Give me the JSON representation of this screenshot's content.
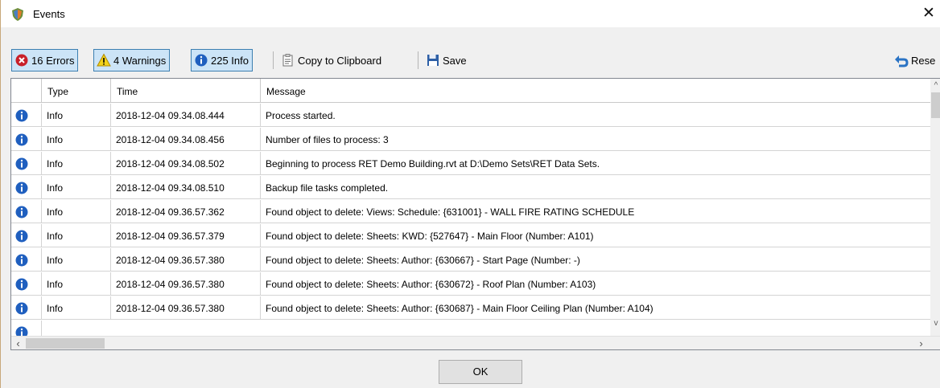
{
  "window": {
    "title": "Events",
    "close_glyph": "✕"
  },
  "toolbar": {
    "errors_label": "16 Errors",
    "warnings_label": "4 Warnings",
    "info_label": "225 Info",
    "copy_label": "Copy to Clipboard",
    "save_label": "Save",
    "reset_label": "Rese"
  },
  "table": {
    "columns": [
      "",
      "Type",
      "Time",
      "Message"
    ],
    "rows": [
      {
        "icon": "info-icon",
        "type": "Info",
        "time": "2018-12-04 09.34.08.444",
        "message": "Process started."
      },
      {
        "icon": "info-icon",
        "type": "Info",
        "time": "2018-12-04 09.34.08.456",
        "message": "Number of files to process: 3"
      },
      {
        "icon": "info-icon",
        "type": "Info",
        "time": "2018-12-04 09.34.08.502",
        "message": "Beginning to process RET Demo Building.rvt at D:\\Demo Sets\\RET Data Sets."
      },
      {
        "icon": "info-icon",
        "type": "Info",
        "time": "2018-12-04 09.34.08.510",
        "message": "Backup file tasks completed."
      },
      {
        "icon": "info-icon",
        "type": "Info",
        "time": "2018-12-04 09.36.57.362",
        "message": "Found object to delete: Views: Schedule: {631001} - WALL FIRE RATING SCHEDULE"
      },
      {
        "icon": "info-icon",
        "type": "Info",
        "time": "2018-12-04 09.36.57.379",
        "message": "Found object to delete: Sheets: KWD: {527647} - Main Floor (Number: A101)"
      },
      {
        "icon": "info-icon",
        "type": "Info",
        "time": "2018-12-04 09.36.57.380",
        "message": "Found object to delete: Sheets: Author: {630667} - Start Page (Number: -)"
      },
      {
        "icon": "info-icon",
        "type": "Info",
        "time": "2018-12-04 09.36.57.380",
        "message": "Found object to delete: Sheets: Author: {630672} - Roof Plan (Number: A103)"
      },
      {
        "icon": "info-icon",
        "type": "Info",
        "time": "2018-12-04 09.36.57.380",
        "message": "Found object to delete: Sheets: Author: {630687} - Main Floor Ceiling Plan (Number: A104)"
      }
    ]
  },
  "footer": {
    "ok_label": "OK"
  },
  "colors": {
    "info_blue": "#1f5fbf",
    "error_red": "#c8202a",
    "warning_yellow": "#f2d21b",
    "toggle_bg": "#cce4f7",
    "toggle_border": "#3c7fb1"
  }
}
